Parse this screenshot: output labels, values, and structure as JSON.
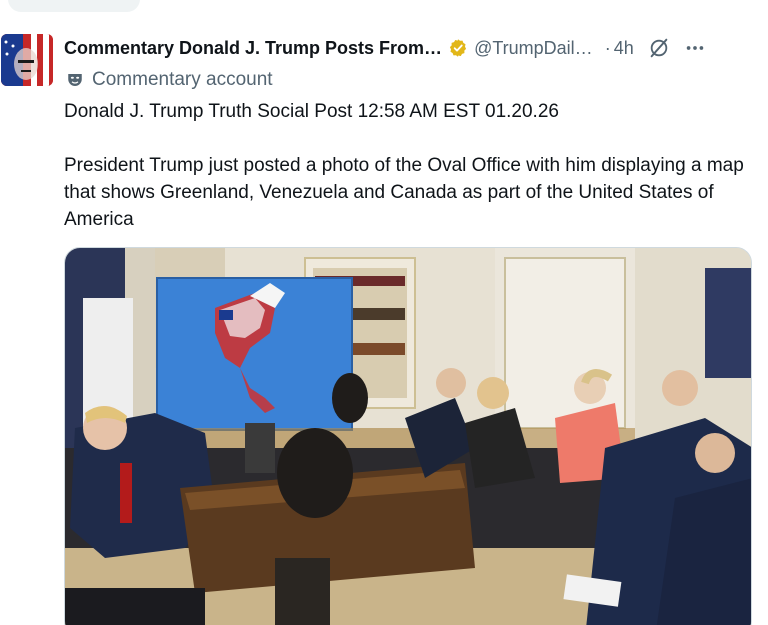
{
  "post": {
    "display_name": "Commentary Donald J. Trump Posts From…",
    "handle": "@TrumpDail…",
    "separator": "·",
    "timestamp": "4h",
    "account_label": "Commentary account",
    "text_line1": "Donald J. Trump Truth Social Post 12:58 AM EST 01.20.26",
    "text_body": "President Trump just posted a photo of the Oval Office with him displaying a map that shows Greenland, Venezuela and Canada as part of the United States of America"
  },
  "icons": {
    "verified": "verified-badge-icon",
    "grok": "grok-icon",
    "more": "more-icon",
    "account_type": "mask-icon"
  },
  "colors": {
    "text": "#0f1419",
    "secondary": "#536471",
    "verified_gold": "#e2b719"
  }
}
